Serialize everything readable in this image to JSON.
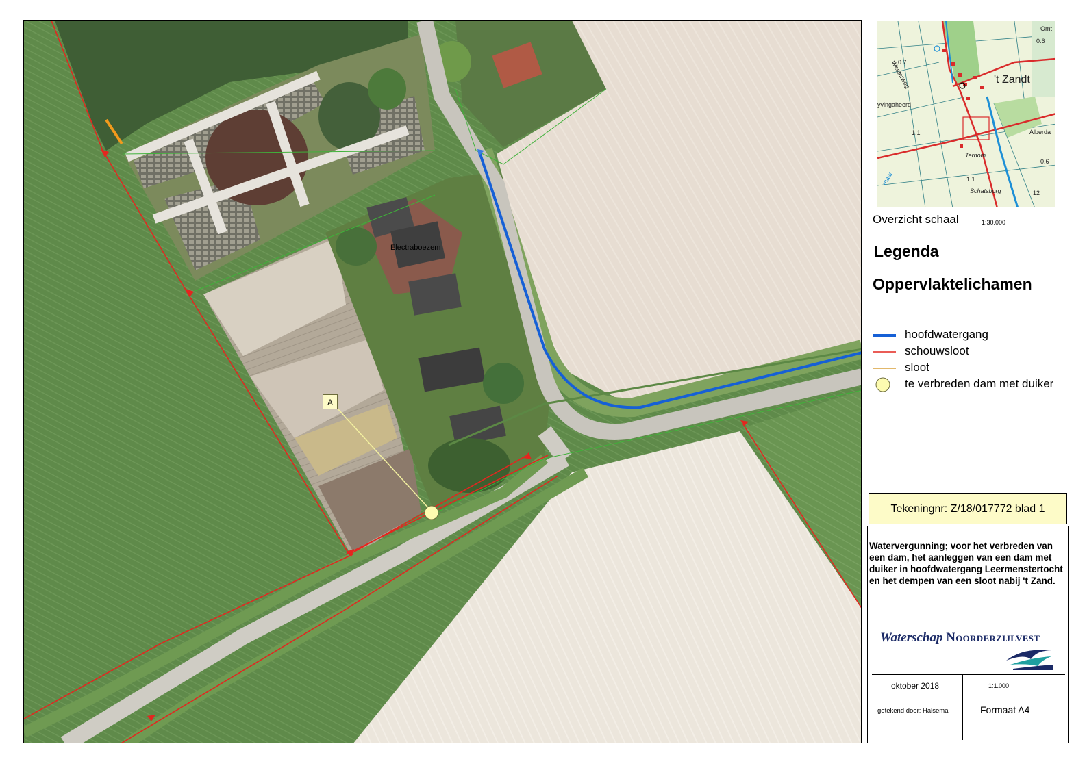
{
  "map": {
    "place_label": "Electraboezem",
    "marker_label": "A"
  },
  "overview": {
    "caption": "Overzicht schaal",
    "scale": "1:30.000",
    "labels": [
      "'t Zandt",
      "Westerweg",
      "yvingaheerd",
      "Alberda",
      "Ternom",
      "Schatsborg",
      "maar",
      "Omt",
      "0.7",
      "0.6",
      "1.1",
      "1.1",
      "0.6",
      "12"
    ]
  },
  "legend": {
    "title": "Legenda",
    "subtitle": "Oppervlaktelichamen",
    "items": [
      {
        "label": "hoofdwatergang",
        "color": "#1660d6",
        "symbol": "line-thick"
      },
      {
        "label": "schouwsloot",
        "color": "#e3261f",
        "symbol": "line"
      },
      {
        "label": "sloot",
        "color": "#d9a03a",
        "symbol": "line"
      },
      {
        "label": "te verbreden dam met duiker",
        "color": "#fdfbb0",
        "symbol": "circle"
      }
    ]
  },
  "title_block": {
    "drawing_number": "Tekeningnr: Z/18/017772 blad 1",
    "description": "Watervergunning; voor het verbreden van een dam, het aanleggen van een dam met duiker in hoofdwatergang Leermenstertocht en het dempen van een sloot nabij 't Zand.",
    "organization": {
      "prefix": "Waterschap",
      "name": "Noorderzijlvest"
    },
    "date": "oktober 2018",
    "scale": "1:1.000",
    "drawn_by": "getekend door: Halsema",
    "format": "Formaat  A4"
  }
}
